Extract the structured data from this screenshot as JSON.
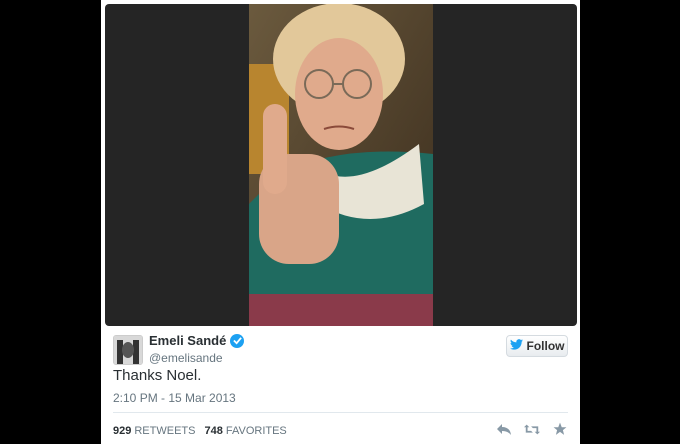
{
  "tweet": {
    "author_name": "Emeli Sandé",
    "author_handle": "@emelisande",
    "text": "Thanks Noel.",
    "timestamp": "2:10 PM - 15 Mar 2013",
    "follow_label": "Follow",
    "retweets_count": "929",
    "retweets_label": "RETWEETS",
    "favorites_count": "748",
    "favorites_label": "FAVORITES"
  },
  "colors": {
    "twitter_blue": "#1da1f2",
    "text_primary": "#292f33",
    "text_secondary": "#66757f",
    "media_background": "#252525"
  },
  "icons": {
    "verified": "verified-badge-icon",
    "follow": "twitter-bird-icon",
    "reply": "reply-icon",
    "retweet": "retweet-icon",
    "favorite": "star-icon"
  }
}
